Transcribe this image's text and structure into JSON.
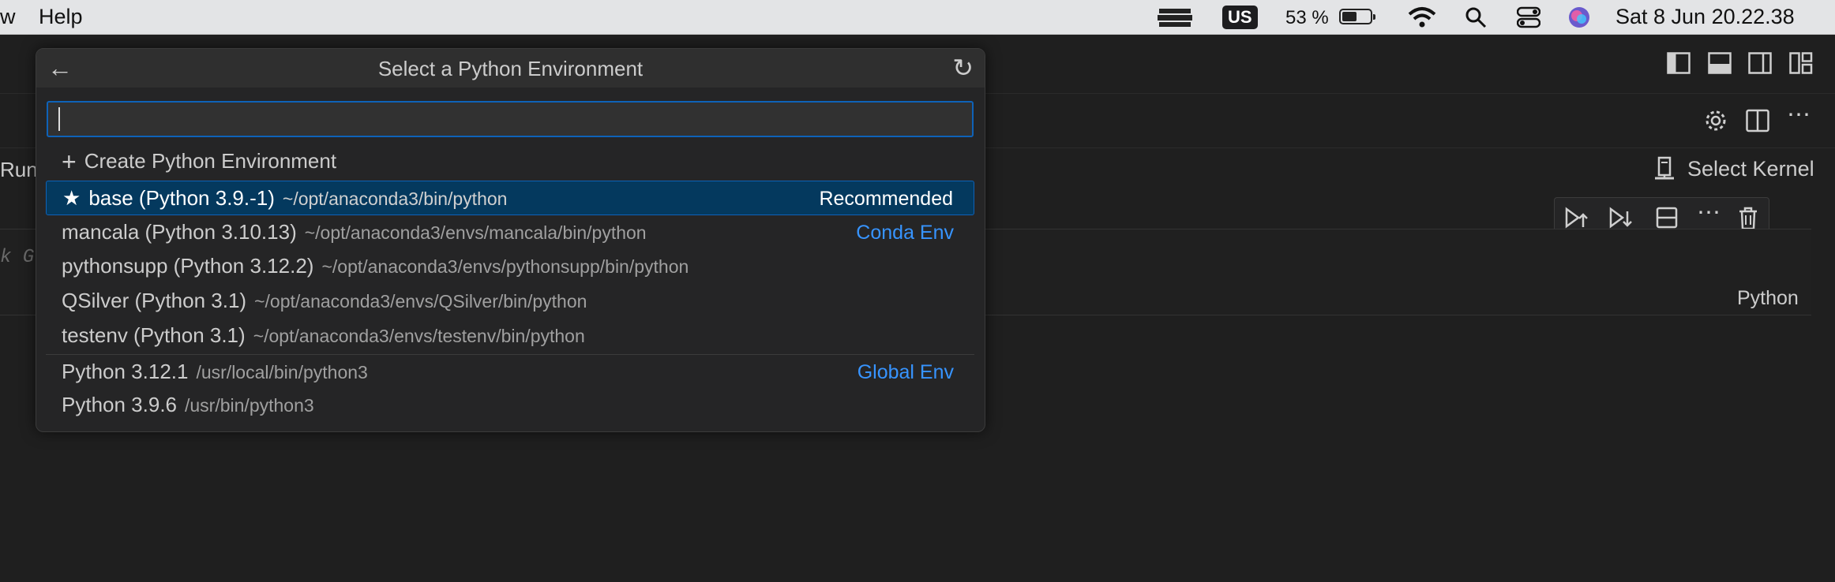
{
  "menubar": {
    "partial_item": "w",
    "help": "Help",
    "input_source": "US",
    "battery_percent": "53 %",
    "battery_level": 0.53,
    "datetime": "Sat 8 Jun  20.22.38"
  },
  "editor": {
    "run_label": "Run",
    "select_kernel": "Select Kernel",
    "cell_code": "k G",
    "cell_language": "Python"
  },
  "quickpick": {
    "title": "Select a Python Environment",
    "input_value": "",
    "create_label": "Create Python Environment",
    "conda_items": [
      {
        "name": "base (Python 3.9.-1)",
        "path": "~/opt/anaconda3/bin/python",
        "tag": "Recommended",
        "selected": true
      },
      {
        "name": "mancala (Python 3.10.13)",
        "path": "~/opt/anaconda3/envs/mancala/bin/python",
        "tag": "Conda Env"
      },
      {
        "name": "pythonsupp (Python 3.12.2)",
        "path": "~/opt/anaconda3/envs/pythonsupp/bin/python",
        "tag": ""
      },
      {
        "name": "QSilver (Python 3.1)",
        "path": "~/opt/anaconda3/envs/QSilver/bin/python",
        "tag": ""
      },
      {
        "name": "testenv (Python 3.1)",
        "path": "~/opt/anaconda3/envs/testenv/bin/python",
        "tag": ""
      }
    ],
    "global_items": [
      {
        "name": "Python 3.12.1",
        "path": "/usr/local/bin/python3",
        "tag": "Global Env"
      },
      {
        "name": "Python 3.9.6",
        "path": "/usr/bin/python3",
        "tag": ""
      }
    ]
  }
}
